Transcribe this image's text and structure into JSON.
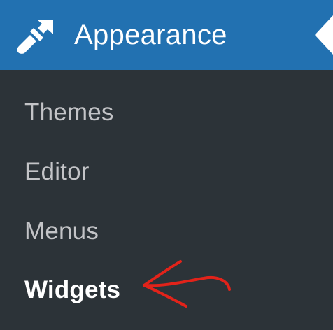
{
  "menu": {
    "section_title": "Appearance",
    "section_icon": "paintbrush-icon",
    "collapse_icon": "collapse-arrow-icon",
    "items": [
      {
        "label": "Themes",
        "current": false
      },
      {
        "label": "Editor",
        "current": false
      },
      {
        "label": "Menus",
        "current": false
      },
      {
        "label": "Widgets",
        "current": true
      }
    ]
  },
  "annotation": {
    "icon": "red-arrow-icon",
    "color": "#e2231a"
  },
  "colors": {
    "header_bg": "#2271b1",
    "menu_bg": "#2c3338",
    "item_text": "#c3c4c7",
    "current_text": "#ffffff"
  }
}
